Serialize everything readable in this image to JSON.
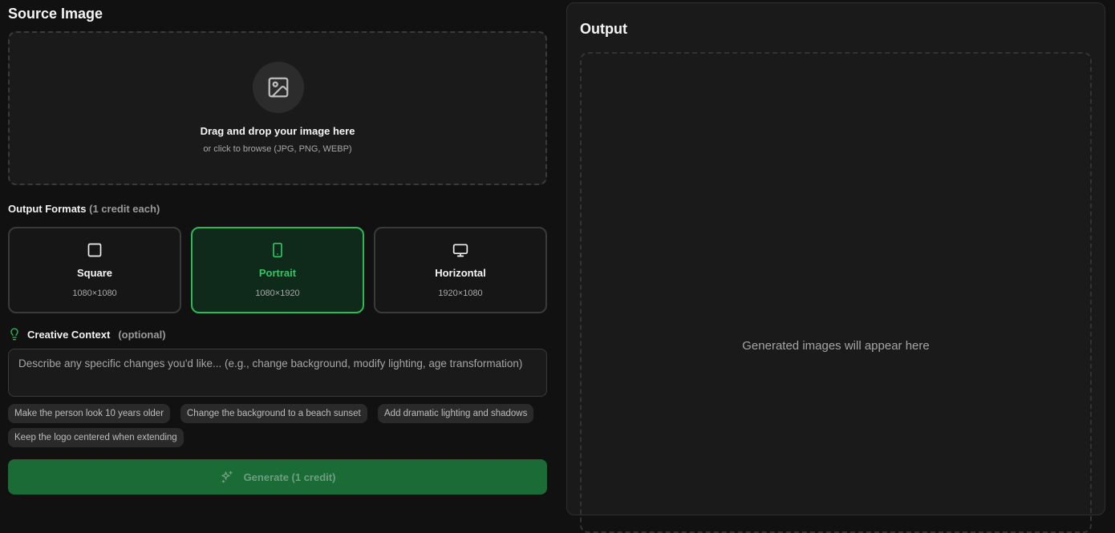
{
  "source": {
    "title": "Source Image",
    "dropzone": {
      "icon": "image-icon",
      "title": "Drag and drop your image here",
      "subtitle": "or click to browse (JPG, PNG, WEBP)"
    }
  },
  "formats": {
    "label": "Output Formats",
    "label_note": "(1 credit each)",
    "items": [
      {
        "name": "Square",
        "dims": "1080×1080",
        "icon": "square-icon",
        "selected": false
      },
      {
        "name": "Portrait",
        "dims": "1080×1920",
        "icon": "smartphone-icon",
        "selected": true
      },
      {
        "name": "Horizontal",
        "dims": "1920×1080",
        "icon": "monitor-icon",
        "selected": false
      }
    ]
  },
  "context": {
    "label": "Creative Context",
    "label_note": "(optional)",
    "icon": "lightbulb-icon",
    "value": "",
    "placeholder": "Describe any specific changes you'd like... (e.g., change background, modify lighting, age transformation)",
    "suggestions": [
      "Make the person look 10 years older",
      "Change the background to a beach sunset",
      "Add dramatic lighting and shadows",
      "Keep the logo centered when extending"
    ]
  },
  "generate": {
    "label": "Generate (1 credit)",
    "icon": "sparkles-icon"
  },
  "output": {
    "title": "Output",
    "empty_message": "Generated images will appear here"
  },
  "colors": {
    "accent": "#2fb85a",
    "button": "#1b6b37",
    "background": "#111111"
  }
}
